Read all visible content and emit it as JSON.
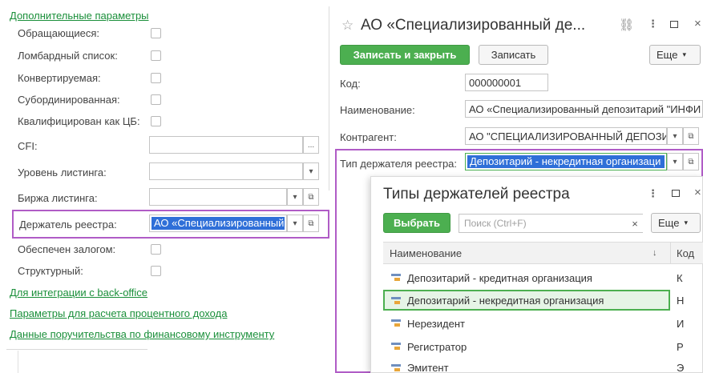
{
  "left": {
    "header_link": "Дополнительные параметры",
    "checkbox_rows": [
      {
        "label": "Обращающиеся:"
      },
      {
        "label": "Ломбардный список:"
      },
      {
        "label": "Конвертируемая:"
      },
      {
        "label": "Субординированная:"
      },
      {
        "label": "Квалифицирован как ЦБ:"
      }
    ],
    "cfi_label": "CFI:",
    "cfi_btn": "...",
    "listing_level_label": "Уровень листинга:",
    "exchange_label": "Биржа листинга:",
    "registry_holder_label": "Держатель реестра:",
    "registry_holder_value": "АО «Специализированный",
    "collateral_label": "Обеспечен залогом:",
    "structured_label": "Структурный:",
    "links": [
      "Для интеграции с back-office",
      "Параметры для расчета процентного дохода",
      "Данные поручительства по финансовому инструменту"
    ]
  },
  "form": {
    "title": "АО «Специализированный де...",
    "save_close": "Записать и закрыть",
    "save": "Записать",
    "more": "Еще",
    "code_label": "Код:",
    "code_value": "000000001",
    "name_label": "Наименование:",
    "name_value": "АО «Специализированный депозитарий \"ИНФИ",
    "contractor_label": "Контрагент:",
    "contractor_value": "АО \"СПЕЦИАЛИЗИРОВАННЫЙ ДЕПОЗИ",
    "holder_type_label": "Тип держателя реестра:",
    "holder_type_value": "Депозитарий - некредитная организаци"
  },
  "popup": {
    "title": "Типы держателей реестра",
    "select_btn": "Выбрать",
    "search_placeholder": "Поиск (Ctrl+F)",
    "more": "Еще",
    "col_name": "Наименование",
    "col_code": "Код",
    "rows": [
      {
        "name": "Депозитарий - кредитная организация",
        "code": "К"
      },
      {
        "name": "Депозитарий - некредитная организация",
        "code": "Н"
      },
      {
        "name": "Нерезидент",
        "code": "И"
      },
      {
        "name": "Регистратор",
        "code": "Р"
      },
      {
        "name": "Эмитент",
        "code": "Э"
      }
    ]
  },
  "colors": {
    "link_green": "#1a8f3a",
    "button_green": "#4caf50",
    "highlight_purple": "#b05cc6",
    "selection_blue": "#2f6fd8",
    "row_highlight": "#e6f4e6"
  }
}
